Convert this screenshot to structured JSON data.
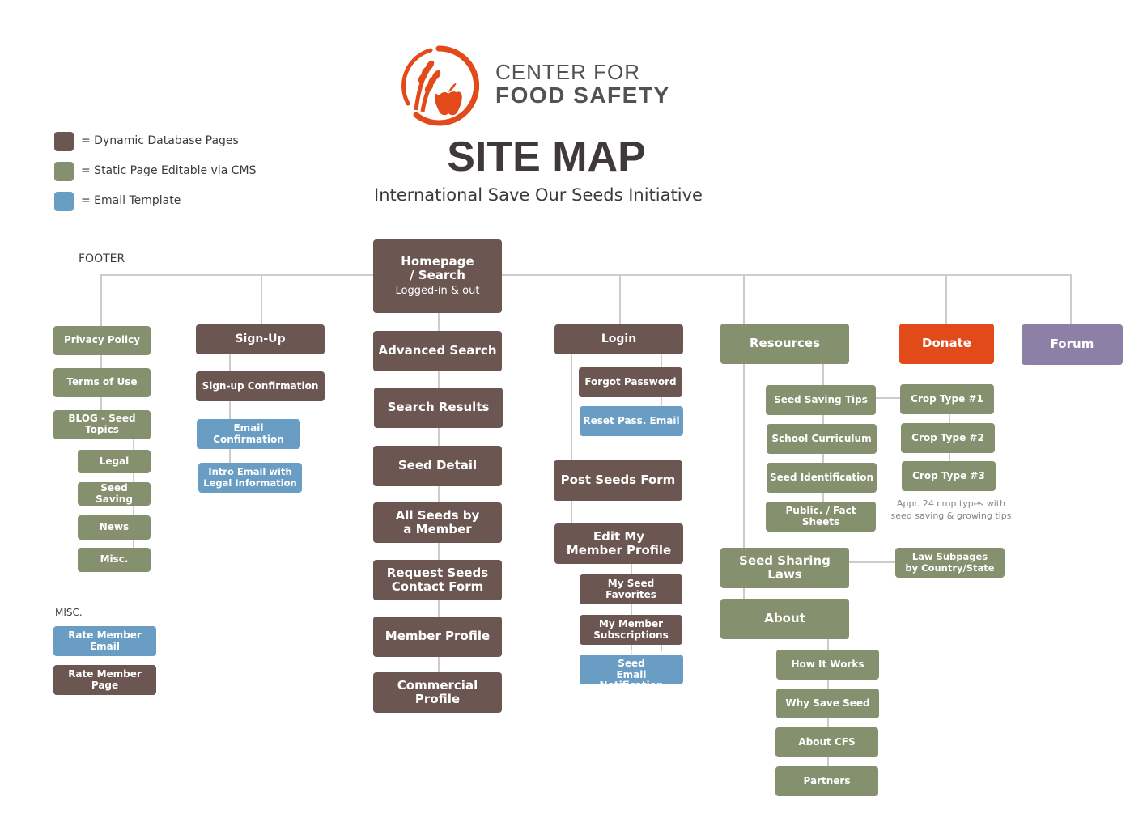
{
  "logo": {
    "line1": "CENTER FOR",
    "line2": "FOOD SAFETY",
    "brand_color": "#e34a1a"
  },
  "title": "SITE MAP",
  "subtitle": "International Save Our Seeds Initiative",
  "legend": [
    {
      "label": "= Dynamic Database Pages",
      "color": "#6b5651"
    },
    {
      "label": "= Static Page Editable via CMS",
      "color": "#85906f"
    },
    {
      "label": "= Email Template",
      "color": "#6a9dc4"
    }
  ],
  "colors": {
    "dynamic": "#6b5651",
    "static": "#85906f",
    "email": "#6a9dc4",
    "donate": "#e34a1a",
    "forum": "#8d80a6",
    "connector": "#cfcacb"
  },
  "footer": {
    "label": "FOOTER",
    "items": [
      "Privacy Policy",
      "Terms of Use",
      "BLOG - Seed Topics"
    ],
    "blog_children": [
      "Legal",
      "Seed Saving",
      "News",
      "Misc."
    ]
  },
  "misc": {
    "label": "MISC.",
    "items": [
      "Rate Member Email",
      "Rate Member Page"
    ]
  },
  "signup": {
    "label": "Sign-Up",
    "children": [
      "Sign-up Confirmation",
      "Email Confirmation",
      "Intro Email with\nLegal Information"
    ]
  },
  "home": {
    "label": "Homepage\n/ Search",
    "sublabel": "Logged-in & out",
    "children": [
      "Advanced Search",
      "Search Results",
      "Seed Detail",
      "All Seeds by\na Member",
      "Request Seeds\nContact Form",
      "Member Profile",
      "Commercial  Profile"
    ]
  },
  "login": {
    "label": "Login",
    "children": [
      "Forgot Password",
      "Reset Pass. Email"
    ],
    "post_seeds": "Post Seeds Form",
    "edit_profile": "Edit My\nMember Profile",
    "profile_children": [
      "My Seed Favorites",
      "My Member\nSubscriptions",
      "Member New Seed\nEmail Notification"
    ]
  },
  "resources": {
    "label": "Resources",
    "children": [
      "Seed Saving Tips",
      "School Curriculum",
      "Seed Identification",
      "Public. / Fact Sheets"
    ],
    "crop_types": [
      "Crop Type #1",
      "Crop Type #2",
      "Crop Type #3"
    ],
    "crop_note": "Appr. 24 crop types with\nseed saving & growing tips",
    "seed_laws": "Seed Sharing Laws",
    "law_subpages": "Law Subpages\nby Country/State",
    "about": "About",
    "about_children": [
      "How It Works",
      "Why Save Seed",
      "About CFS",
      "Partners"
    ]
  },
  "donate": "Donate",
  "forum": "Forum"
}
